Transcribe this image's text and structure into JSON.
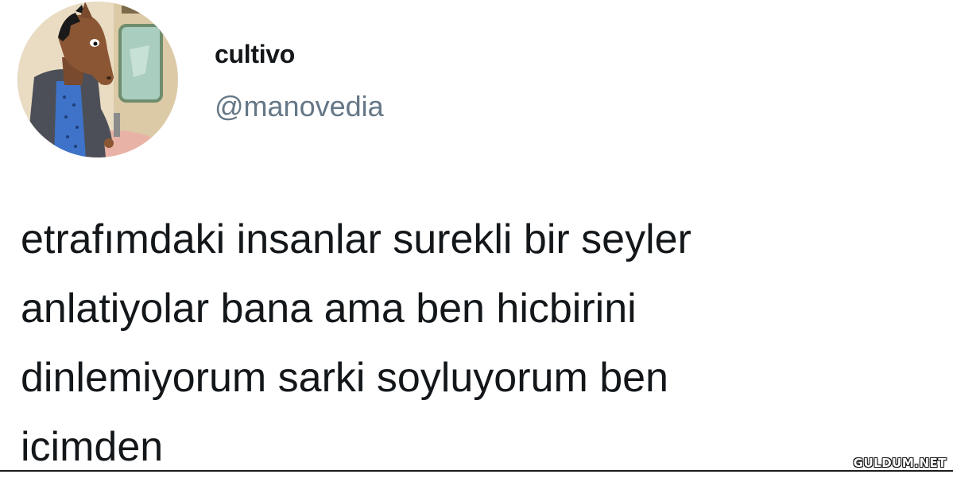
{
  "user": {
    "display_name": "cultivo",
    "handle": "@manovedia",
    "avatar_icon": "cartoon-horse-avatar-icon"
  },
  "tweet": {
    "lines": [
      "etrafımdaki insanlar surekli bir seyler",
      "anlatiyolar bana ama ben hicbirini",
      "dinlemiyorum sarki soyluyorum ben",
      "icimden"
    ]
  },
  "watermark": {
    "text": "GULDUM.NET"
  },
  "colors": {
    "text": "#14171a",
    "handle": "#657786",
    "background": "#ffffff"
  }
}
